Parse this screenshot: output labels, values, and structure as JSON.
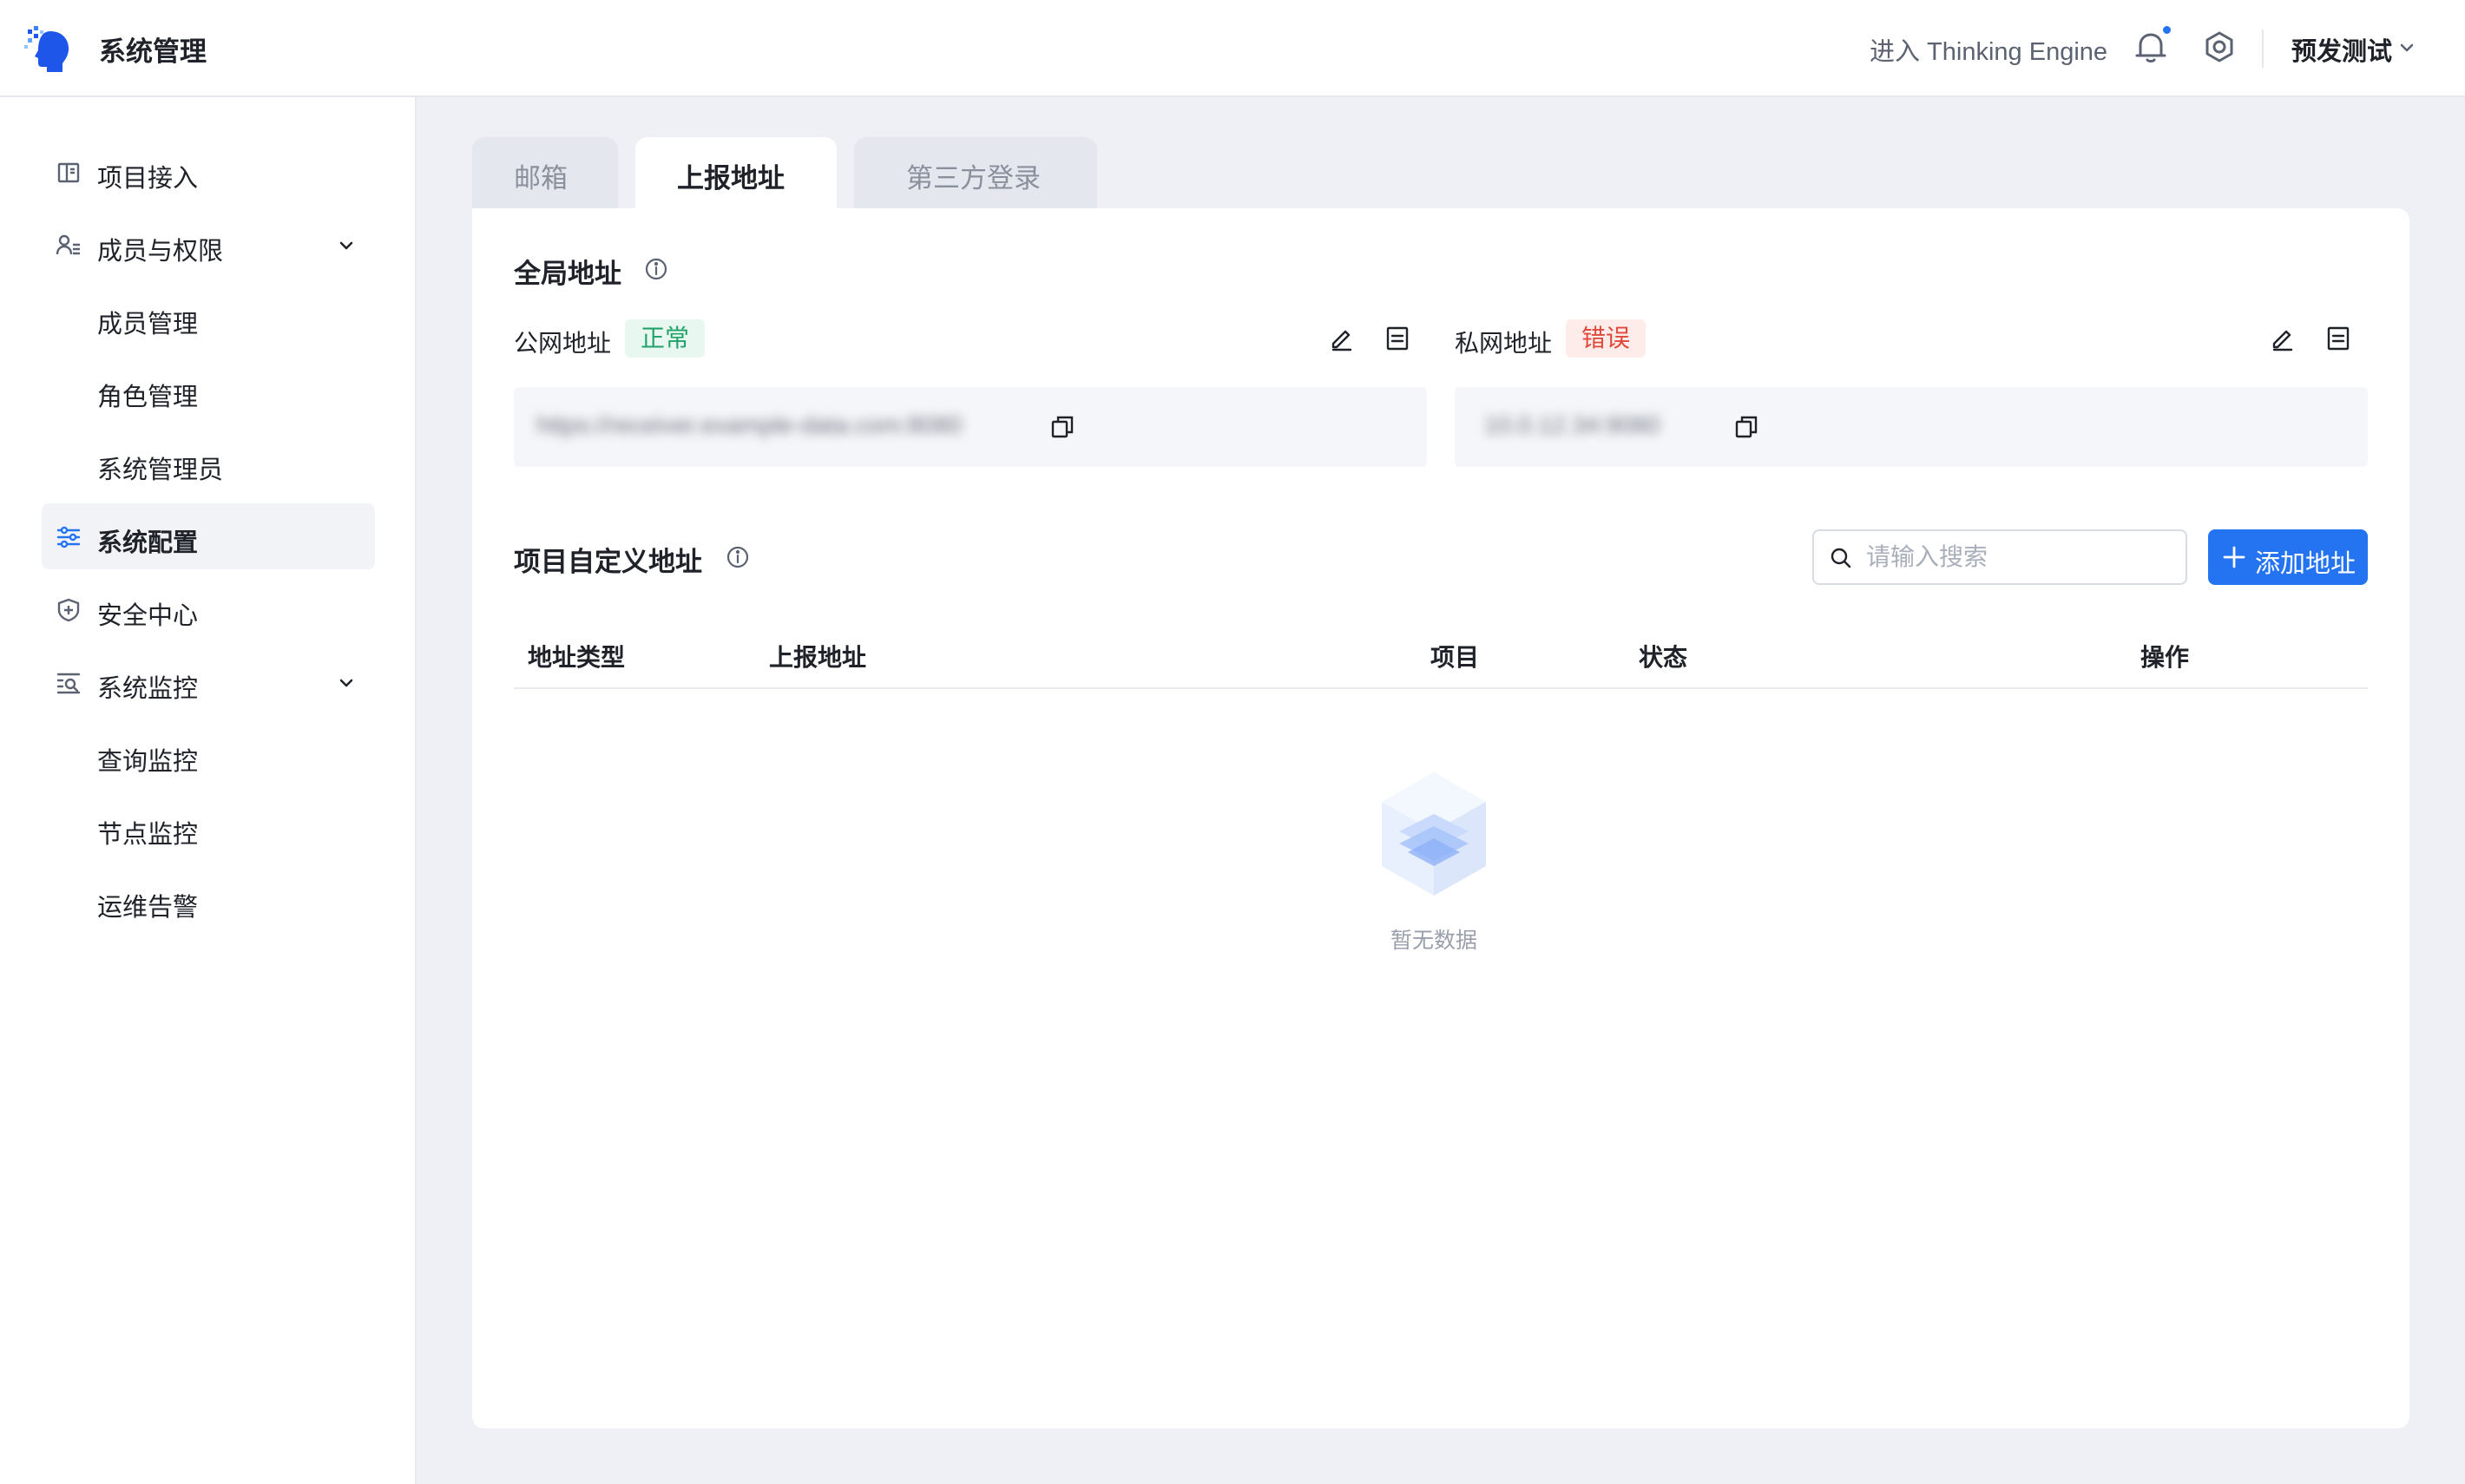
{
  "header": {
    "app_title": "系统管理",
    "enter_link": "进入 Thinking Engine",
    "environment": "预发测试",
    "logo_icon": "head-logo-icon",
    "notification_icon": "bell-icon",
    "settings_icon": "gear-icon",
    "accent_color": "#2474f2"
  },
  "sidebar": {
    "items": [
      {
        "label": "项目接入",
        "icon": "book-icon"
      },
      {
        "label": "成员与权限",
        "icon": "users-icon",
        "expanded": true
      },
      {
        "label": "成员管理"
      },
      {
        "label": "角色管理"
      },
      {
        "label": "系统管理员"
      },
      {
        "label": "系统配置",
        "icon": "sliders-icon",
        "active": true
      },
      {
        "label": "安全中心",
        "icon": "shield-icon"
      },
      {
        "label": "系统监控",
        "icon": "monitor-search-icon",
        "expanded": true
      },
      {
        "label": "查询监控"
      },
      {
        "label": "节点监控"
      },
      {
        "label": "运维告警"
      }
    ]
  },
  "tabs": [
    {
      "label": "邮箱",
      "active": false
    },
    {
      "label": "上报地址",
      "active": true
    },
    {
      "label": "第三方登录",
      "active": false
    }
  ],
  "global_address": {
    "title": "全局地址",
    "public": {
      "label": "公网地址",
      "status": "正常",
      "value": "https://receiver.example-data.com:8080"
    },
    "private": {
      "label": "私网地址",
      "status": "错误",
      "value": "10.0.12.34:9080"
    }
  },
  "project_address": {
    "title": "项目自定义地址",
    "search_placeholder": "请输入搜索",
    "add_button": "添加地址",
    "columns": [
      "地址类型",
      "上报地址",
      "项目",
      "状态",
      "操作"
    ],
    "rows": [],
    "empty_text": "暂无数据"
  }
}
